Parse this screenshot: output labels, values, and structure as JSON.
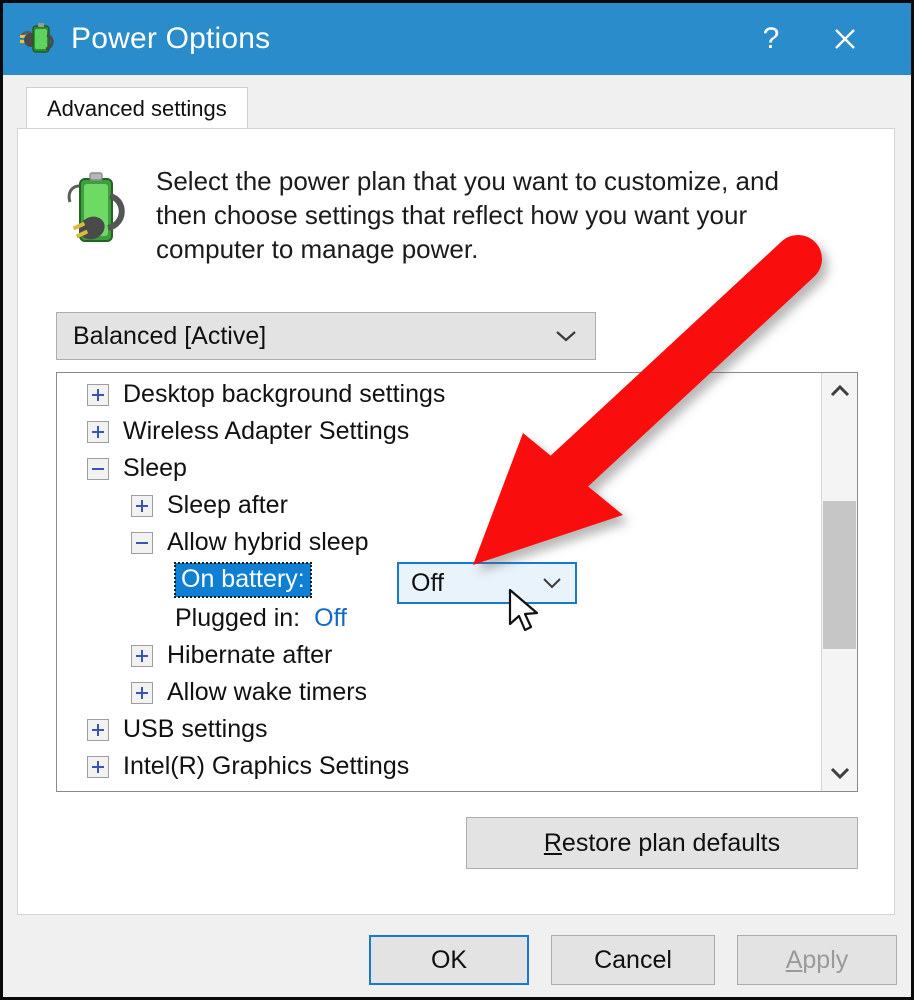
{
  "window": {
    "title": "Power Options",
    "icon": "battery-plug-icon",
    "help_label": "?",
    "close_label": "✕",
    "titlebar_color": "#2b8ccc"
  },
  "tabs": [
    {
      "label": "Advanced settings",
      "selected": true
    }
  ],
  "header": {
    "icon": "battery-plug-icon",
    "description": "Select the power plan that you want to customize, and then choose settings that reflect how you want your computer to manage power."
  },
  "plan_combo": {
    "name": "power-plan-select",
    "value": "Balanced [Active]",
    "arrow": "chevron-down-icon"
  },
  "tree": {
    "rows": [
      {
        "kind": "node",
        "indent": 0,
        "expander": "plus",
        "label": "Desktop background settings"
      },
      {
        "kind": "node",
        "indent": 0,
        "expander": "plus",
        "label": "Wireless Adapter Settings"
      },
      {
        "kind": "node",
        "indent": 0,
        "expander": "minus",
        "label": "Sleep"
      },
      {
        "kind": "node",
        "indent": 1,
        "expander": "plus",
        "label": "Sleep after"
      },
      {
        "kind": "node",
        "indent": 1,
        "expander": "minus",
        "label": "Allow hybrid sleep"
      },
      {
        "kind": "value-combo",
        "indent": 2,
        "label": "On battery:",
        "value": "Off",
        "selected": true
      },
      {
        "kind": "value",
        "indent": 2,
        "label": "Plugged in:",
        "value": "Off",
        "selected": false
      },
      {
        "kind": "node",
        "indent": 1,
        "expander": "plus",
        "label": "Hibernate after"
      },
      {
        "kind": "node",
        "indent": 1,
        "expander": "plus",
        "label": "Allow wake timers"
      },
      {
        "kind": "node",
        "indent": 0,
        "expander": "plus",
        "label": "USB settings"
      },
      {
        "kind": "node",
        "indent": 0,
        "expander": "plus",
        "label": "Intel(R) Graphics Settings"
      }
    ],
    "scrollbar": {
      "up_arrow": "chevron-up-icon",
      "down_arrow": "chevron-down-icon"
    }
  },
  "buttons": {
    "restore": {
      "label": "Restore plan defaults",
      "accel": "R",
      "enabled": true
    },
    "ok": {
      "label": "OK",
      "enabled": true,
      "default": true
    },
    "cancel": {
      "label": "Cancel",
      "enabled": true
    },
    "apply": {
      "label": "Apply",
      "accel": "A",
      "enabled": false
    }
  },
  "annotation": {
    "arrow_color": "#fa0a0a",
    "points_to": "On battery: dropdown"
  },
  "colors": {
    "accent": "#2b8ccc",
    "selection": "#0f7fd4",
    "link": "#1469c7",
    "annotation": "#fa0a0a"
  }
}
